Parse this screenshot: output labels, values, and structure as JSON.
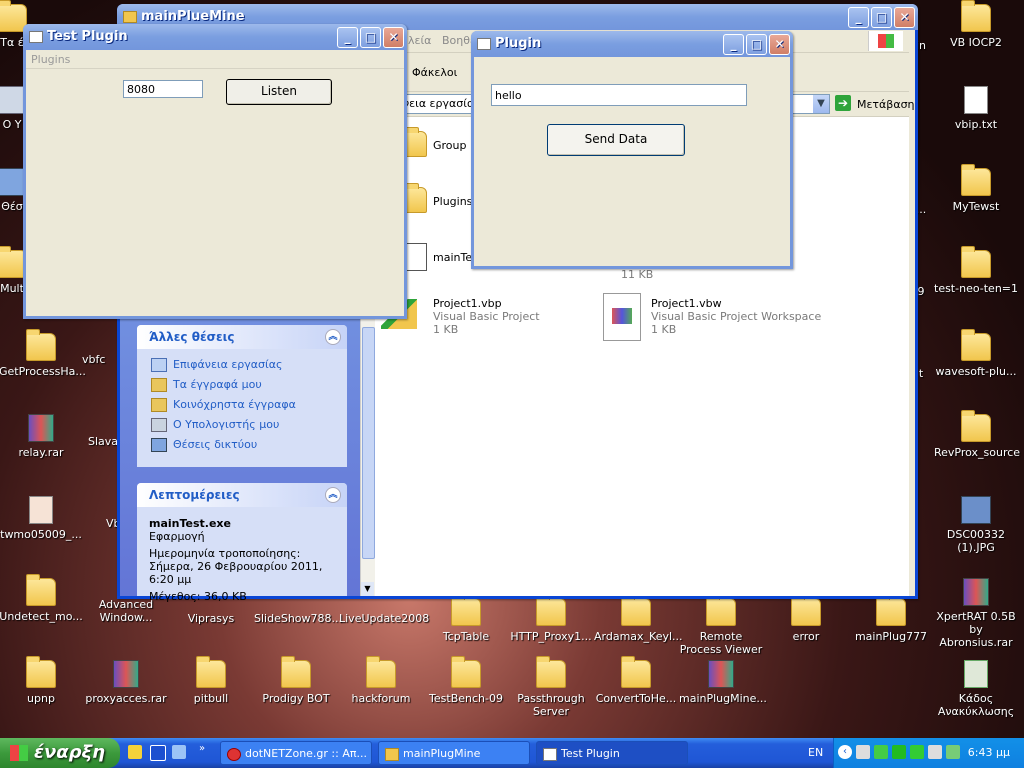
{
  "desktop": {
    "right_icons": [
      {
        "label": "VB IOCP2",
        "kind": "folder"
      },
      {
        "label": "vbip.txt",
        "kind": "file"
      },
      {
        "label": "MyTewst",
        "kind": "folder"
      },
      {
        "label": "test-neo-ten=1",
        "kind": "folder"
      },
      {
        "label": "wavesoft-plu...",
        "kind": "folder"
      },
      {
        "label": "RevProx_source",
        "kind": "folder"
      },
      {
        "label": "DSC00332 (1).JPG",
        "kind": "image"
      },
      {
        "label": "XpertRAT 0.5B by Abronsius.rar",
        "kind": "rar"
      },
      {
        "label": "Κάδος Ανακύκλωσης",
        "kind": "recycle"
      }
    ],
    "left_icons": [
      {
        "label": "Τα έ",
        "kind": "folder"
      },
      {
        "label": "Ο Υ",
        "kind": "computer"
      },
      {
        "label": "Θέσ",
        "kind": "network"
      },
      {
        "label": "Mult",
        "kind": "folder"
      },
      {
        "label": "GetProcessHa...",
        "kind": "folder"
      },
      {
        "label": "relay.rar",
        "kind": "rar"
      },
      {
        "label": "twmo05009_...",
        "kind": "file"
      },
      {
        "label": "Undetect_mo...",
        "kind": "folder"
      },
      {
        "label": "upnp",
        "kind": "folder"
      }
    ],
    "col2_partial": [
      {
        "label": "vbfc"
      },
      {
        "label": "Slava"
      },
      {
        "label": "Vb"
      }
    ],
    "row1": [
      "Advanced Window...",
      "Viprasys",
      "SlideShow788...",
      "LiveUpdate2008",
      "TcpTable",
      "HTTP_Proxy1...",
      "Ardamax_Keyl...",
      "Remote Process Viewer",
      "error",
      "mainPlug777"
    ],
    "row2": [
      "proxyacces.rar",
      "pitbull",
      "Prodigy BOT",
      "hackforum",
      "TestBench-09",
      "Passthrough Server",
      "ConvertToHe...",
      "mainPlugMine..."
    ],
    "right_partial": [
      "in",
      "...",
      "...",
      "9",
      "t"
    ]
  },
  "explorer": {
    "title": "mainPlueMine",
    "menu_partial": [
      "λεία",
      "Βοηθε"
    ],
    "toolbar_folders": "Φάκελοι",
    "address_partial": "νεια εργασίας",
    "go_label": "Μετάβαση",
    "files": [
      {
        "name": "Group",
        "sub1": "",
        "sub2": "",
        "kind": "folder"
      },
      {
        "name": "Plugins",
        "sub1": "",
        "sub2": "",
        "kind": "folder"
      },
      {
        "name": "mainTest",
        "sub1": "",
        "sub2": "",
        "kind": "exe"
      },
      {
        "name": "",
        "sub1": "",
        "sub2": "11 KB",
        "kind": "hidden"
      },
      {
        "name": "Project1.vbp",
        "sub1": "Visual Basic Project",
        "sub2": "1 KB",
        "kind": "vbp"
      },
      {
        "name": "Project1.vbw",
        "sub1": "Visual Basic Project Workspace",
        "sub2": "1 KB",
        "kind": "vbw"
      }
    ],
    "other_places": {
      "heading": "Άλλες θέσεις",
      "links": [
        "Επιφάνεια εργασίας",
        "Τα έγγραφά μου",
        "Κοινόχρηστα έγγραφα",
        "Ο Υπολογιστής μου",
        "Θέσεις δικτύου"
      ]
    },
    "details": {
      "heading": "Λεπτομέρειες",
      "name": "mainTest.exe",
      "type": "Εφαρμογή",
      "modified": "Ημερομηνία τροποποίησης: Σήμερα, 26 Φεβρουαρίου 2011, 6:20 μμ",
      "size": "Μέγεθος: 36,0 KB"
    }
  },
  "test_plugin": {
    "title": "Test Plugin",
    "menu": "Plugins",
    "port_value": "8080",
    "listen_label": "Listen"
  },
  "plugin": {
    "title": "Plugin",
    "text_value": "hello",
    "send_label": "Send Data"
  },
  "taskbar": {
    "start_label": "έναρξη",
    "tasks": [
      "dotNETZone.gr :: Απ...",
      "mainPlugMine",
      "Test Plugin"
    ],
    "lang": "EN",
    "time": "6:43 μμ"
  },
  "colors": {
    "xp_blue": "#0a46d5",
    "start_green": "#3c9a3c",
    "link_blue": "#215dc6"
  }
}
